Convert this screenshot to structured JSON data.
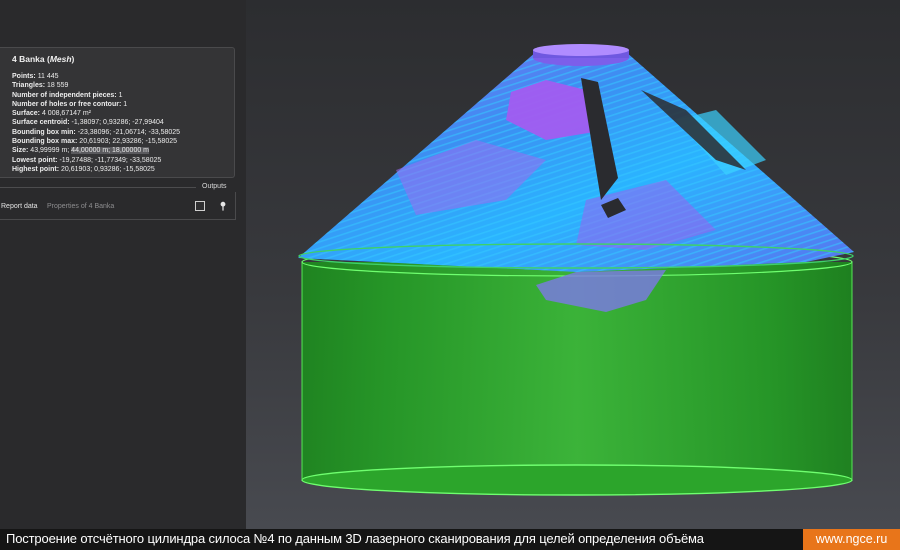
{
  "info": {
    "title": "4 Banka",
    "title_type": "Mesh",
    "properties": [
      {
        "label": "Points:",
        "value": "11 445"
      },
      {
        "label": "Triangles:",
        "value": "18 559"
      },
      {
        "label": "Number of independent pieces:",
        "value": "1"
      },
      {
        "label": "Number of holes or free contour:",
        "value": "1"
      },
      {
        "label": "Surface:",
        "value": "4 008,67147 m²"
      },
      {
        "label": "Surface centroid:",
        "value": "-1,38097; 0,93286; -27,99404"
      },
      {
        "label": "Bounding box min:",
        "value": "-23,38096; -21,06714; -33,58025"
      },
      {
        "label": "Bounding box max:",
        "value": "20,61903; 22,93286; -15,58025"
      },
      {
        "label": "Size:",
        "value": "43,99999 m;",
        "value_hl": "44,00000 m; 18,00000 m"
      },
      {
        "label": "Lowest point:",
        "value": "-19,27488; -11,77349; -33,58025"
      },
      {
        "label": "Highest point:",
        "value": "20,61903; 0,93286; -15,58025"
      }
    ]
  },
  "outputs": {
    "section_label": "Outputs",
    "report_label": "Report data",
    "report_value": "Properties of 4 Banka",
    "checkbox_checked": false,
    "pin_icon": "pin-icon"
  },
  "caption": {
    "text": "Построение отсчётного цилиндра силоса №4 по данным 3D лазерного сканирования для целей определения объёма",
    "site": "www.ngce.ru"
  },
  "colors": {
    "cylinder_green": "#2fae2c",
    "cylinder_edge": "#6fff6f",
    "mesh_blue": "#2aa8ff",
    "mesh_purple": "#a25cf0",
    "badge_orange": "#e8751a"
  }
}
